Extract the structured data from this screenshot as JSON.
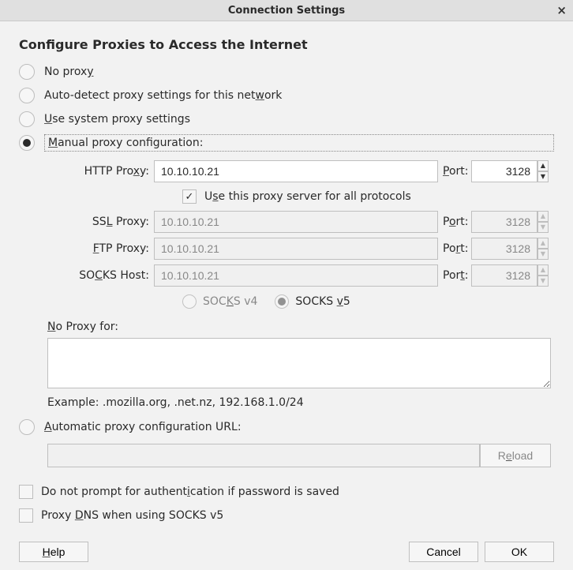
{
  "window": {
    "title": "Connection Settings"
  },
  "heading": "Configure Proxies to Access the Internet",
  "radios": {
    "no_proxy": {
      "pre": "No prox",
      "u": "y",
      "post": ""
    },
    "auto_detect": {
      "pre": "Auto-detect proxy settings for this net",
      "u": "w",
      "post": "ork"
    },
    "system": {
      "pre": "",
      "u": "U",
      "post": "se system proxy settings"
    },
    "manual": {
      "pre": "",
      "u": "M",
      "post": "anual proxy configuration:"
    }
  },
  "proxy": {
    "http": {
      "label_pre": "HTTP Pro",
      "label_u": "x",
      "label_post": "y:",
      "host": "10.10.10.21",
      "port": "3128",
      "port_pre": "",
      "port_u": "P",
      "port_post": "ort:",
      "enabled": true
    },
    "use_all": {
      "pre": "U",
      "u": "s",
      "post": "e this proxy server for all protocols",
      "checked": true
    },
    "ssl": {
      "label_pre": "SS",
      "label_u": "L",
      "label_post": " Proxy:",
      "host": "10.10.10.21",
      "port": "3128",
      "port_pre": "P",
      "port_u": "o",
      "port_post": "rt:",
      "enabled": false
    },
    "ftp": {
      "label_pre": "",
      "label_u": "F",
      "label_post": "TP Proxy:",
      "host": "10.10.10.21",
      "port": "3128",
      "port_pre": "Po",
      "port_u": "r",
      "port_post": "t:",
      "enabled": false
    },
    "socks": {
      "label_pre": "SO",
      "label_u": "C",
      "label_post": "KS Host:",
      "host": "10.10.10.21",
      "port": "3128",
      "port_pre": "Por",
      "port_u": "t",
      "port_post": ":",
      "enabled": false
    },
    "socks_v4": {
      "pre": "SOC",
      "u": "K",
      "post": "S v4"
    },
    "socks_v5": {
      "pre": "SOCKS ",
      "u": "v",
      "post": "5"
    }
  },
  "no_proxy_for": {
    "label_pre": "",
    "label_u": "N",
    "label_post": "o Proxy for:",
    "value": ""
  },
  "example": "Example: .mozilla.org, .net.nz, 192.168.1.0/24",
  "auto_url": {
    "label_pre": "",
    "label_u": "A",
    "label_post": "utomatic proxy configuration URL:",
    "value": "",
    "reload_pre": "R",
    "reload_u": "e",
    "reload_post": "load"
  },
  "checks": {
    "no_prompt": {
      "pre": "Do not prompt for authent",
      "u": "i",
      "post": "cation if password is saved"
    },
    "proxy_dns": {
      "pre": "Proxy ",
      "u": "D",
      "post": "NS when using SOCKS v5"
    }
  },
  "buttons": {
    "help": {
      "pre": "",
      "u": "H",
      "post": "elp"
    },
    "cancel": "Cancel",
    "ok": "OK"
  }
}
